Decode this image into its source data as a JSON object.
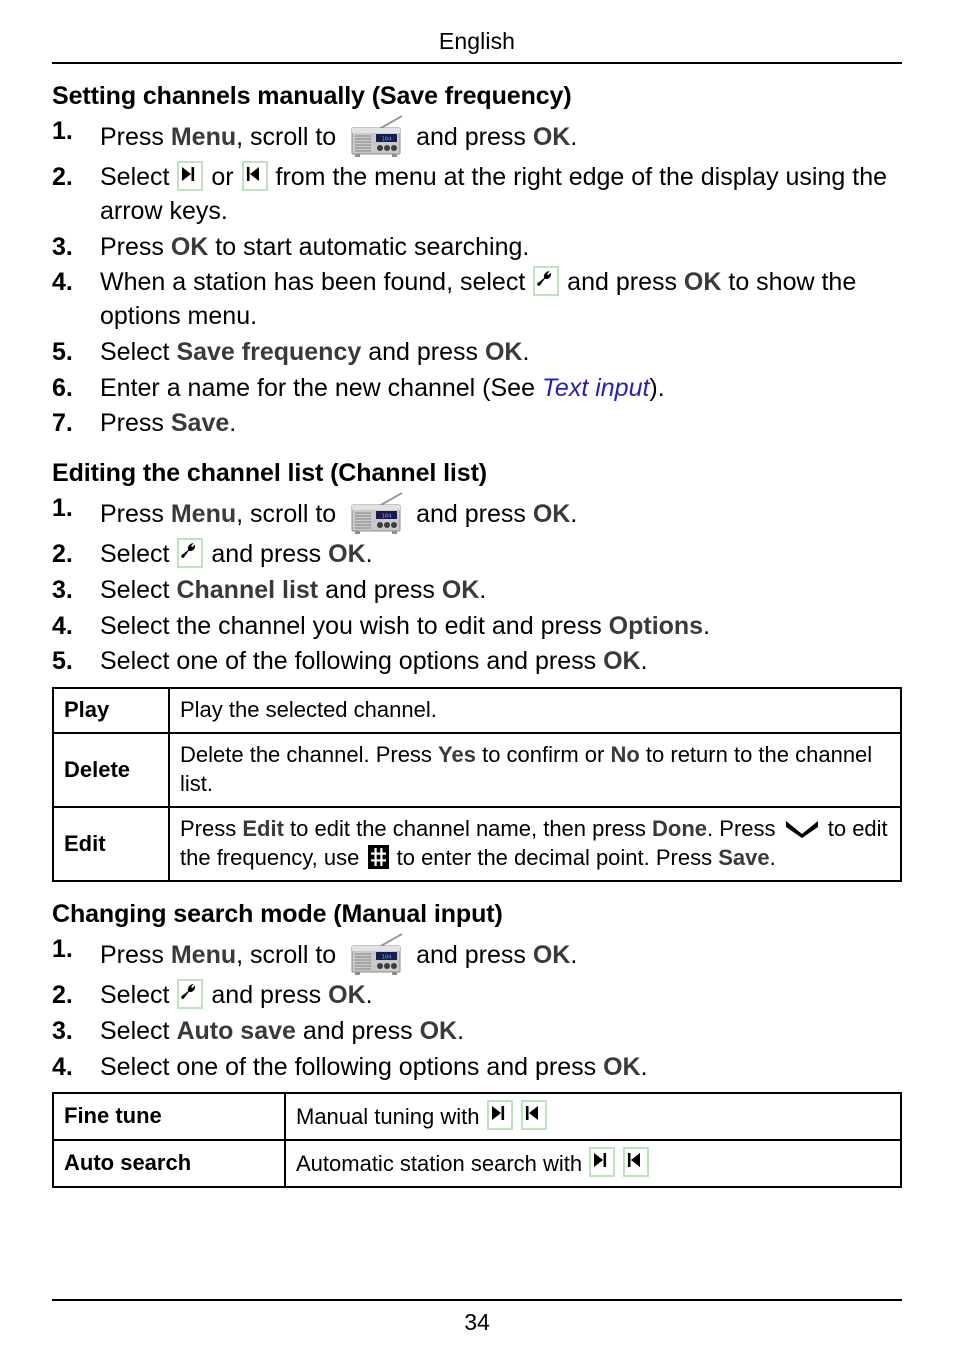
{
  "header": {
    "title": "English"
  },
  "footer": {
    "page_number": "34"
  },
  "sections": [
    {
      "id": "setting-channels-manually",
      "title": "Setting channels manually (Save frequency)",
      "steps": [
        {
          "num": "1.",
          "parts": [
            {
              "t": "text",
              "v": "Press "
            },
            {
              "t": "ui",
              "v": "Menu"
            },
            {
              "t": "text",
              "v": ", scroll to "
            },
            {
              "t": "icon",
              "v": "radio-icon"
            },
            {
              "t": "text",
              "v": " and press "
            },
            {
              "t": "ui",
              "v": "OK"
            },
            {
              "t": "text",
              "v": "."
            }
          ]
        },
        {
          "num": "2.",
          "parts": [
            {
              "t": "text",
              "v": "Select "
            },
            {
              "t": "icon",
              "v": "skip-forward-icon"
            },
            {
              "t": "text",
              "v": " or "
            },
            {
              "t": "icon",
              "v": "skip-back-icon"
            },
            {
              "t": "text",
              "v": " from the menu at the right edge of the display using the arrow keys."
            }
          ]
        },
        {
          "num": "3.",
          "parts": [
            {
              "t": "text",
              "v": "Press "
            },
            {
              "t": "ui",
              "v": "OK"
            },
            {
              "t": "text",
              "v": " to start automatic searching."
            }
          ]
        },
        {
          "num": "4.",
          "parts": [
            {
              "t": "text",
              "v": "When a station has been found, select "
            },
            {
              "t": "icon",
              "v": "wrench-icon"
            },
            {
              "t": "text",
              "v": " and press "
            },
            {
              "t": "ui",
              "v": "OK"
            },
            {
              "t": "text",
              "v": " to show the options menu."
            }
          ]
        },
        {
          "num": "5.",
          "parts": [
            {
              "t": "text",
              "v": "Select "
            },
            {
              "t": "ui",
              "v": "Save frequency"
            },
            {
              "t": "text",
              "v": " and press "
            },
            {
              "t": "ui",
              "v": "OK"
            },
            {
              "t": "text",
              "v": "."
            }
          ]
        },
        {
          "num": "6.",
          "parts": [
            {
              "t": "text",
              "v": "Enter a name for the new channel (See "
            },
            {
              "t": "link",
              "v": "Text input"
            },
            {
              "t": "text",
              "v": ")."
            }
          ]
        },
        {
          "num": "7.",
          "parts": [
            {
              "t": "text",
              "v": "Press "
            },
            {
              "t": "ui",
              "v": "Save"
            },
            {
              "t": "text",
              "v": "."
            }
          ]
        }
      ]
    },
    {
      "id": "editing-the-channel-list",
      "title": "Editing the channel list (Channel list)",
      "steps": [
        {
          "num": "1.",
          "parts": [
            {
              "t": "text",
              "v": "Press "
            },
            {
              "t": "ui",
              "v": "Menu"
            },
            {
              "t": "text",
              "v": ", scroll to "
            },
            {
              "t": "icon",
              "v": "radio-icon"
            },
            {
              "t": "text",
              "v": " and press "
            },
            {
              "t": "ui",
              "v": "OK"
            },
            {
              "t": "text",
              "v": "."
            }
          ]
        },
        {
          "num": "2.",
          "parts": [
            {
              "t": "text",
              "v": "Select "
            },
            {
              "t": "icon",
              "v": "wrench-icon"
            },
            {
              "t": "text",
              "v": " and press "
            },
            {
              "t": "ui",
              "v": "OK"
            },
            {
              "t": "text",
              "v": "."
            }
          ]
        },
        {
          "num": "3.",
          "parts": [
            {
              "t": "text",
              "v": "Select "
            },
            {
              "t": "ui",
              "v": "Channel list"
            },
            {
              "t": "text",
              "v": " and press "
            },
            {
              "t": "ui",
              "v": "OK"
            },
            {
              "t": "text",
              "v": "."
            }
          ]
        },
        {
          "num": "4.",
          "parts": [
            {
              "t": "text",
              "v": "Select the channel you wish to edit and press "
            },
            {
              "t": "ui",
              "v": "Options"
            },
            {
              "t": "text",
              "v": "."
            }
          ]
        },
        {
          "num": "5.",
          "parts": [
            {
              "t": "text",
              "v": "Select one of the following options and press "
            },
            {
              "t": "ui",
              "v": "OK"
            },
            {
              "t": "text",
              "v": "."
            }
          ]
        }
      ],
      "table": {
        "id": "channel-options-table",
        "rows": [
          {
            "label": "Play",
            "parts": [
              {
                "t": "text",
                "v": "Play the selected channel."
              }
            ]
          },
          {
            "label": "Delete",
            "parts": [
              {
                "t": "text",
                "v": "Delete the channel. Press "
              },
              {
                "t": "ui",
                "v": "Yes"
              },
              {
                "t": "text",
                "v": " to confirm or "
              },
              {
                "t": "ui",
                "v": "No"
              },
              {
                "t": "text",
                "v": " to return to the channel list."
              }
            ]
          },
          {
            "label": "Edit",
            "parts": [
              {
                "t": "text",
                "v": "Press "
              },
              {
                "t": "ui",
                "v": "Edit"
              },
              {
                "t": "text",
                "v": " to edit the channel name, then press "
              },
              {
                "t": "ui",
                "v": "Done"
              },
              {
                "t": "text",
                "v": ". Press "
              },
              {
                "t": "icon",
                "v": "chevron-down-icon"
              },
              {
                "t": "text",
                "v": " to edit the frequency, use "
              },
              {
                "t": "icon",
                "v": "hash-key-icon"
              },
              {
                "t": "text",
                "v": " to enter the decimal point. Press "
              },
              {
                "t": "ui",
                "v": "Save"
              },
              {
                "t": "text",
                "v": "."
              }
            ]
          }
        ]
      }
    },
    {
      "id": "changing-search-mode",
      "title": "Changing search mode (Manual input)",
      "steps": [
        {
          "num": "1.",
          "parts": [
            {
              "t": "text",
              "v": "Press "
            },
            {
              "t": "ui",
              "v": "Menu"
            },
            {
              "t": "text",
              "v": ", scroll to "
            },
            {
              "t": "icon",
              "v": "radio-icon"
            },
            {
              "t": "text",
              "v": " and press "
            },
            {
              "t": "ui",
              "v": "OK"
            },
            {
              "t": "text",
              "v": "."
            }
          ]
        },
        {
          "num": "2.",
          "parts": [
            {
              "t": "text",
              "v": "Select "
            },
            {
              "t": "icon",
              "v": "wrench-icon"
            },
            {
              "t": "text",
              "v": " and press "
            },
            {
              "t": "ui",
              "v": "OK"
            },
            {
              "t": "text",
              "v": "."
            }
          ]
        },
        {
          "num": "3.",
          "parts": [
            {
              "t": "text",
              "v": "Select "
            },
            {
              "t": "ui",
              "v": "Auto save"
            },
            {
              "t": "text",
              "v": " and press "
            },
            {
              "t": "ui",
              "v": "OK"
            },
            {
              "t": "text",
              "v": "."
            }
          ]
        },
        {
          "num": "4.",
          "parts": [
            {
              "t": "text",
              "v": "Select one of the following options and press "
            },
            {
              "t": "ui",
              "v": "OK"
            },
            {
              "t": "text",
              "v": "."
            }
          ]
        }
      ],
      "table": {
        "id": "search-mode-table",
        "rows": [
          {
            "label": "Fine tune",
            "parts": [
              {
                "t": "text",
                "v": "Manual tuning with "
              },
              {
                "t": "icon",
                "v": "skip-forward-icon"
              },
              {
                "t": "text",
                "v": " "
              },
              {
                "t": "icon",
                "v": "skip-back-icon"
              }
            ]
          },
          {
            "label": "Auto search",
            "parts": [
              {
                "t": "text",
                "v": "Automatic station search with "
              },
              {
                "t": "icon",
                "v": "skip-forward-icon"
              },
              {
                "t": "text",
                "v": " "
              },
              {
                "t": "icon",
                "v": "skip-back-icon"
              }
            ]
          }
        ]
      }
    }
  ],
  "colors": {
    "ui_term": "#3a3a3a",
    "link": "#2222bb",
    "icon_border_green": "#bfe3c0",
    "radio_body": "#b8b8b8",
    "radio_display": "#1a1a4e"
  }
}
